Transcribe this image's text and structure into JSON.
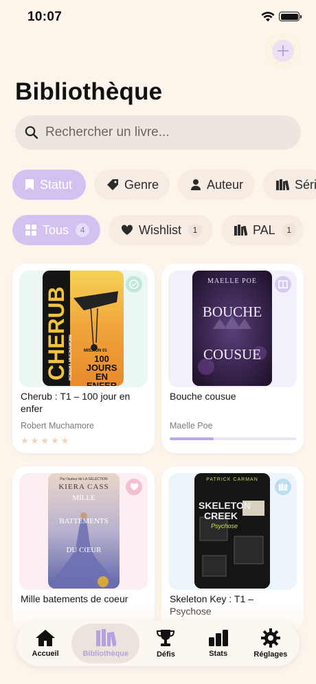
{
  "status": {
    "time": "10:07"
  },
  "header": {
    "title": "Bibliothèque"
  },
  "search": {
    "placeholder": "Rechercher un livre..."
  },
  "filters": [
    {
      "label": "Statut",
      "icon": "bookmark-icon",
      "active": true
    },
    {
      "label": "Genre",
      "icon": "tag-icon",
      "active": false
    },
    {
      "label": "Auteur",
      "icon": "person-icon",
      "active": false
    },
    {
      "label": "Séri",
      "icon": "books-icon",
      "active": false
    }
  ],
  "status_filters": [
    {
      "label": "Tous",
      "count": "4",
      "icon": "grid-icon",
      "active": true
    },
    {
      "label": "Wishlist",
      "count": "1",
      "icon": "heart-icon",
      "active": false
    },
    {
      "label": "PAL",
      "count": "1",
      "icon": "books-icon",
      "active": false
    }
  ],
  "books": [
    {
      "title": "Cherub : T1 – 100 jour en enfer",
      "author": "Robert Muchamore",
      "badge": "check-icon",
      "rating_stars": "★★★★★",
      "rating": 0,
      "progress": null,
      "badge_color": "#bfe8db",
      "card_tint": "#eaf7f2"
    },
    {
      "title": "Bouche cousue",
      "author": "Maelle Poe",
      "badge": "open-book-icon",
      "progress": 0.35,
      "badge_color": "#d7c9f2",
      "card_tint": "#f3effb"
    },
    {
      "title": "Mille batements de coeur",
      "author": "",
      "badge": "heart-icon",
      "progress": null,
      "badge_color": "#f6bfd0",
      "card_tint": "#fdeef2"
    },
    {
      "title": "Skeleton Key : T1 – Psychose",
      "author": "",
      "badge": "books-icon",
      "progress": null,
      "badge_color": "#bdddf0",
      "card_tint": "#edf5fb"
    }
  ],
  "covers": {
    "cherub": {
      "series": "CHERUB",
      "author": "ROBERT MUCHAMORE",
      "subtitle": "MISSION 01",
      "tag": "100 JOURS EN ENFER"
    },
    "bouche": {
      "author": "MAELLE POE",
      "title_line1": "BOUCHE",
      "title_line2": "COUSUE"
    },
    "mille": {
      "series_note": "Par l'auteur de LA SÉLECTION",
      "author": "KIERA CASS",
      "title_line1": "MILLE",
      "title_line2": "BATTEMENTS",
      "title_line3": "DU CŒUR"
    },
    "skeleton": {
      "author": "PATRICK CARMAN",
      "title_line1": "SKELETON",
      "title_line2": "CREEK",
      "subtitle": "Psychose"
    }
  },
  "tabbar": [
    {
      "label": "Accueil",
      "icon": "home-icon",
      "active": false
    },
    {
      "label": "Bibliothèque",
      "icon": "library-icon",
      "active": true
    },
    {
      "label": "Défis",
      "icon": "trophy-icon",
      "active": false
    },
    {
      "label": "Stats",
      "icon": "bar-chart-icon",
      "active": false
    },
    {
      "label": "Réglages",
      "icon": "gear-icon",
      "active": false
    }
  ]
}
